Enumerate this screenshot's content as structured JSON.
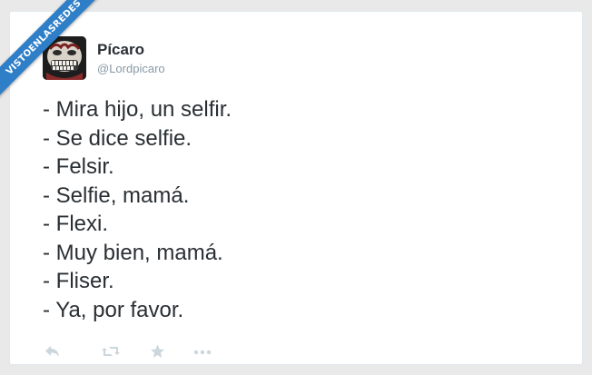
{
  "watermark": {
    "text": "VISTOENLASREDES"
  },
  "tweet": {
    "author": {
      "name": "Pícaro",
      "handle": "@Lordpicaro",
      "avatar_icon": "skull-grin-icon"
    },
    "lines": [
      "- Mira hijo, un selfir.",
      "- Se dice selfie.",
      "- Felsir.",
      "- Selfie, mamá.",
      "- Flexi.",
      "- Muy bien, mamá.",
      "- Fliser.",
      "- Ya, por favor."
    ],
    "actions": [
      {
        "icon": "reply-icon"
      },
      {
        "icon": "retweet-icon"
      },
      {
        "icon": "favorite-star-icon"
      },
      {
        "icon": "more-options-icon"
      }
    ]
  },
  "colors": {
    "page_background": "#e9e9e9",
    "card_background": "#ffffff",
    "text_primary": "#292f33",
    "text_secondary": "#8899a6",
    "action_icon": "#ccd6dd",
    "ribbon": "#2e7fc8"
  }
}
